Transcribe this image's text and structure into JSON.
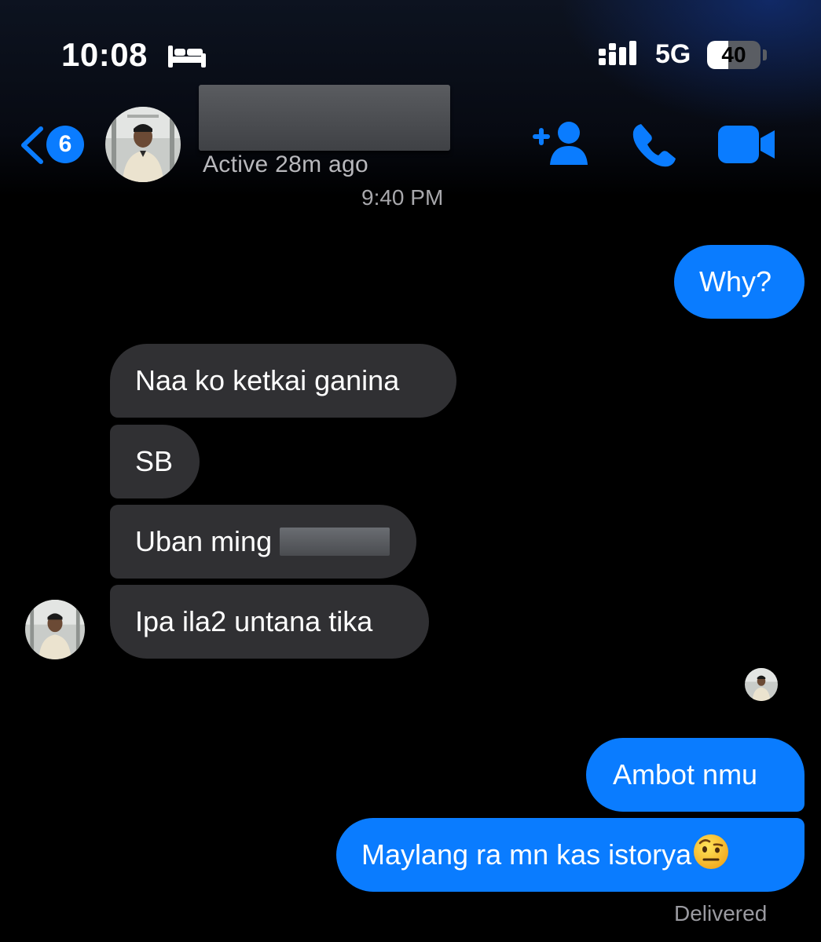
{
  "status_bar": {
    "time": "10:08",
    "focus_icon": "bed-icon",
    "network": "5G",
    "battery": "40",
    "battery_level_percent": 40
  },
  "header": {
    "back_badge_count": "6",
    "contact_name": "",
    "presence": "Active 28m ago",
    "actions": [
      "add-person-icon",
      "phone-icon",
      "video-camera-icon"
    ]
  },
  "conversation": {
    "timestamp": "9:40 PM",
    "messages": [
      {
        "direction": "outgoing",
        "text": "Why?"
      },
      {
        "direction": "incoming",
        "text": "Naa ko ketkai ganina"
      },
      {
        "direction": "incoming",
        "text": "SB"
      },
      {
        "direction": "incoming",
        "text": "Uban ming"
      },
      {
        "direction": "incoming",
        "text": "Ipa ila2 untana tika"
      },
      {
        "direction": "outgoing",
        "text": "Ambot nmu"
      },
      {
        "direction": "outgoing",
        "text": "Maylang ra mn kas istorya",
        "emoji": "face-with-raised-eyebrow"
      }
    ],
    "receipt": "Delivered"
  },
  "colors": {
    "accent": "#0a7cff",
    "incoming_bubble": "#303033",
    "background": "#000000"
  }
}
